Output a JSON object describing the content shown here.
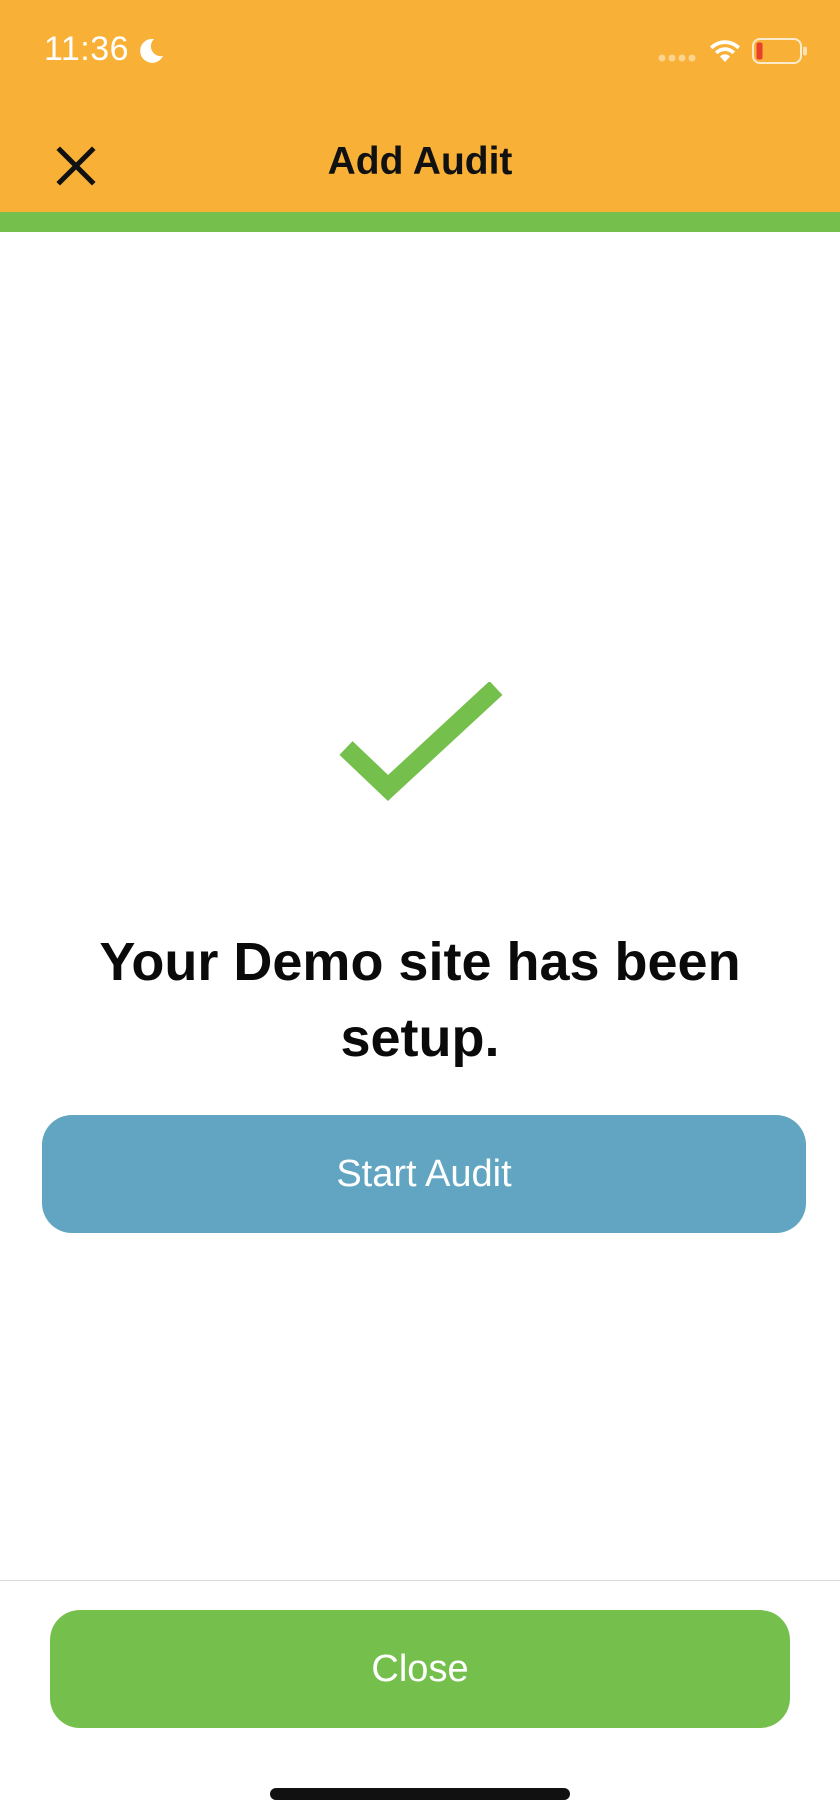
{
  "status_bar": {
    "time": "11:36",
    "icons": [
      "moon-icon",
      "cellular-signal-icon",
      "wifi-icon",
      "battery-low-icon"
    ]
  },
  "nav": {
    "title": "Add Audit",
    "close_icon": "close-icon"
  },
  "colors": {
    "header": "#F8B136",
    "accent_green": "#75C04D",
    "start_button": "#62A5C2",
    "battery_low": "#E8402A"
  },
  "main": {
    "success_icon": "checkmark-icon",
    "message": "Your Demo site has been setup.",
    "start_button_label": "Start Audit"
  },
  "footer": {
    "close_button_label": "Close"
  }
}
